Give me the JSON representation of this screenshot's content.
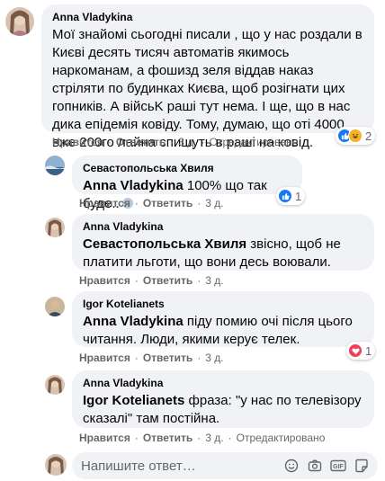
{
  "comments": [
    {
      "author": "Anna Vladykina",
      "mention": "",
      "text": "Мої знайомі сьогодні писали , що у нас роздали в Києві десять тисяч автоматів якимось наркоманам, а фошизд зеля віддав наказ стріляти по будинках Києва, щоб розігнати цих гопників. А війсьK раші тут нема. І ще, що в нас дика епідемія ковіду. Тому, думаю, що оті 4000 вже 200го лайна спишуть в раші на ковід.",
      "like_label": "Нравится",
      "reply_label": "Ответить",
      "time": "3 д.",
      "edited": "Отредактировано",
      "reactions": {
        "icons": [
          "like-icon",
          "haha-icon"
        ],
        "count": "2"
      }
    },
    {
      "author": "Севастопольська Хвиля",
      "mention": "Anna Vladykina",
      "text": "100% що так буде..",
      "like_label": "Нравится",
      "reply_label": "Ответить",
      "time": "3 д.",
      "reactions": {
        "icons": [
          "like-icon"
        ],
        "count": "1"
      }
    },
    {
      "author": "Anna Vladykina",
      "mention": "Севастопольська Хвиля",
      "text": "звісно, щоб не платити льготи, що вони десь воювали.",
      "like_label": "Нравится",
      "reply_label": "Ответить",
      "time": "3 д."
    },
    {
      "author": "Igor Kotelianets",
      "mention": "Anna Vladykina",
      "text": "піду помию очі після цього читання. Люди, якими керує телек.",
      "like_label": "Нравится",
      "reply_label": "Ответить",
      "time": "3 д.",
      "reactions": {
        "icons": [
          "love-icon"
        ],
        "count": "1"
      }
    },
    {
      "author": "Anna Vladykina",
      "mention": "Igor Kotelianets",
      "text": "фраза: \"у нас по телевізору сказалі\" там постійна.",
      "like_label": "Нравится",
      "reply_label": "Ответить",
      "time": "3 д.",
      "edited": "Отредактировано"
    }
  ],
  "composer": {
    "placeholder": "Напишите ответ…",
    "icons": [
      "emoji-icon",
      "camera-icon",
      "gif-icon",
      "sticker-icon"
    ]
  },
  "colors": {
    "bubble": "#f0f2f5",
    "meta": "#65676b",
    "like": "#1877f2",
    "love": "#f33e58",
    "haha": "#f7b125"
  }
}
